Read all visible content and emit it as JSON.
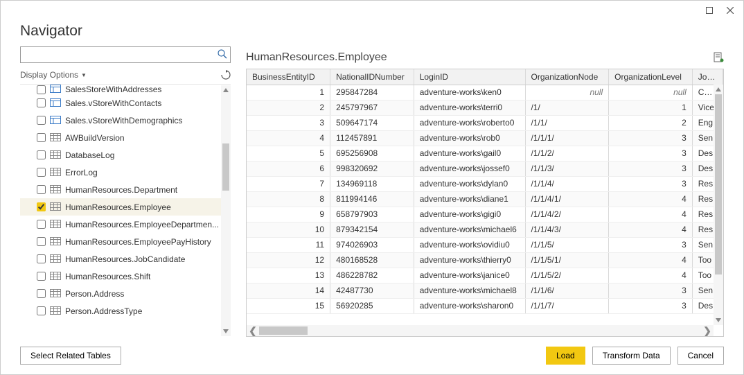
{
  "window": {
    "title": "Navigator"
  },
  "search": {
    "placeholder": ""
  },
  "display_options_label": "Display Options",
  "tree": {
    "items": [
      {
        "label": "SalesStoreWithAddresses",
        "type": "view",
        "checked": false,
        "truncated": true
      },
      {
        "label": "Sales.vStoreWithContacts",
        "type": "view",
        "checked": false
      },
      {
        "label": "Sales.vStoreWithDemographics",
        "type": "view",
        "checked": false
      },
      {
        "label": "AWBuildVersion",
        "type": "table",
        "checked": false
      },
      {
        "label": "DatabaseLog",
        "type": "table",
        "checked": false
      },
      {
        "label": "ErrorLog",
        "type": "table",
        "checked": false
      },
      {
        "label": "HumanResources.Department",
        "type": "table",
        "checked": false
      },
      {
        "label": "HumanResources.Employee",
        "type": "table",
        "checked": true,
        "selected": true
      },
      {
        "label": "HumanResources.EmployeeDepartmen...",
        "type": "table",
        "checked": false
      },
      {
        "label": "HumanResources.EmployeePayHistory",
        "type": "table",
        "checked": false
      },
      {
        "label": "HumanResources.JobCandidate",
        "type": "table",
        "checked": false
      },
      {
        "label": "HumanResources.Shift",
        "type": "table",
        "checked": false
      },
      {
        "label": "Person.Address",
        "type": "table",
        "checked": false
      },
      {
        "label": "Person.AddressType",
        "type": "table",
        "checked": false
      }
    ]
  },
  "preview": {
    "title": "HumanResources.Employee",
    "columns": [
      "BusinessEntityID",
      "NationalIDNumber",
      "LoginID",
      "OrganizationNode",
      "OrganizationLevel",
      "JobTitle"
    ],
    "rows": [
      {
        "id": "1",
        "nid": "295847284",
        "login": "adventure-works\\ken0",
        "node": null,
        "level": null,
        "job": "Chief"
      },
      {
        "id": "2",
        "nid": "245797967",
        "login": "adventure-works\\terri0",
        "node": "/1/",
        "level": "1",
        "job": "Vice"
      },
      {
        "id": "3",
        "nid": "509647174",
        "login": "adventure-works\\roberto0",
        "node": "/1/1/",
        "level": "2",
        "job": "Eng"
      },
      {
        "id": "4",
        "nid": "112457891",
        "login": "adventure-works\\rob0",
        "node": "/1/1/1/",
        "level": "3",
        "job": "Sen"
      },
      {
        "id": "5",
        "nid": "695256908",
        "login": "adventure-works\\gail0",
        "node": "/1/1/2/",
        "level": "3",
        "job": "Des"
      },
      {
        "id": "6",
        "nid": "998320692",
        "login": "adventure-works\\jossef0",
        "node": "/1/1/3/",
        "level": "3",
        "job": "Des"
      },
      {
        "id": "7",
        "nid": "134969118",
        "login": "adventure-works\\dylan0",
        "node": "/1/1/4/",
        "level": "3",
        "job": "Res"
      },
      {
        "id": "8",
        "nid": "811994146",
        "login": "adventure-works\\diane1",
        "node": "/1/1/4/1/",
        "level": "4",
        "job": "Res"
      },
      {
        "id": "9",
        "nid": "658797903",
        "login": "adventure-works\\gigi0",
        "node": "/1/1/4/2/",
        "level": "4",
        "job": "Res"
      },
      {
        "id": "10",
        "nid": "879342154",
        "login": "adventure-works\\michael6",
        "node": "/1/1/4/3/",
        "level": "4",
        "job": "Res"
      },
      {
        "id": "11",
        "nid": "974026903",
        "login": "adventure-works\\ovidiu0",
        "node": "/1/1/5/",
        "level": "3",
        "job": "Sen"
      },
      {
        "id": "12",
        "nid": "480168528",
        "login": "adventure-works\\thierry0",
        "node": "/1/1/5/1/",
        "level": "4",
        "job": "Too"
      },
      {
        "id": "13",
        "nid": "486228782",
        "login": "adventure-works\\janice0",
        "node": "/1/1/5/2/",
        "level": "4",
        "job": "Too"
      },
      {
        "id": "14",
        "nid": "42487730",
        "login": "adventure-works\\michael8",
        "node": "/1/1/6/",
        "level": "3",
        "job": "Sen"
      },
      {
        "id": "15",
        "nid": "56920285",
        "login": "adventure-works\\sharon0",
        "node": "/1/1/7/",
        "level": "3",
        "job": "Des"
      }
    ]
  },
  "footer": {
    "select_related": "Select Related Tables",
    "load": "Load",
    "transform": "Transform Data",
    "cancel": "Cancel"
  }
}
